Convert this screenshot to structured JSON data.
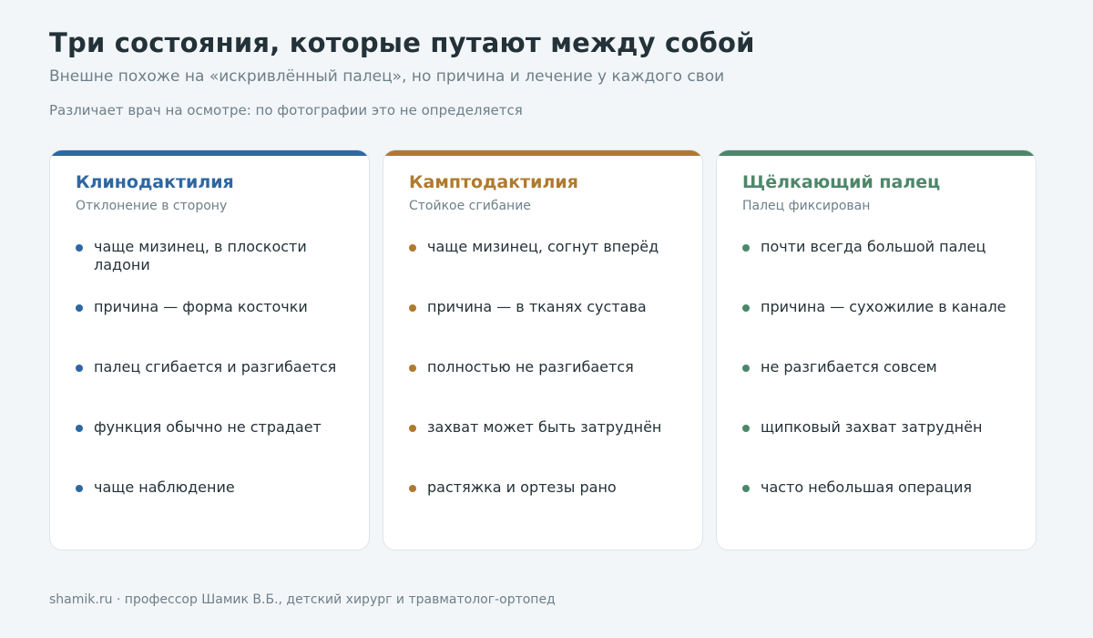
{
  "header": {
    "title": "Три состояния, которые путают между собой",
    "subtitle": "Внешне похоже на «искривлённый палец», но причина и лечение у каждого свои",
    "note": "Различает врач на осмотре: по фотографии это не определяется"
  },
  "cards": [
    {
      "title": "Клинодактилия",
      "subtitle": "Отклонение в сторону",
      "accent": "#2e67a3",
      "items": [
        "чаще мизинец, в плоскости ладони",
        "причина — форма косточки",
        "палец сгибается и разгибается",
        "функция обычно не страдает",
        "чаще наблюдение"
      ]
    },
    {
      "title": "Камптодактилия",
      "subtitle": "Стойкое сгибание",
      "accent": "#b07a2e",
      "items": [
        "чаще мизинец, согнут вперёд",
        "причина — в тканях сустава",
        "полностью не разгибается",
        "захват может быть затруднён",
        "растяжка и ортезы рано"
      ]
    },
    {
      "title": "Щёлкающий палец",
      "subtitle": "Палец фиксирован",
      "accent": "#4d876a",
      "items": [
        "почти всегда большой палец",
        "причина — сухожилие в канале",
        "не разгибается совсем",
        "щипковый захват затруднён",
        "часто небольшая операция"
      ]
    }
  ],
  "footer": {
    "text": "shamik.ru · профессор Шамик В.Б., детский хирург и травматолог-ортопед"
  }
}
